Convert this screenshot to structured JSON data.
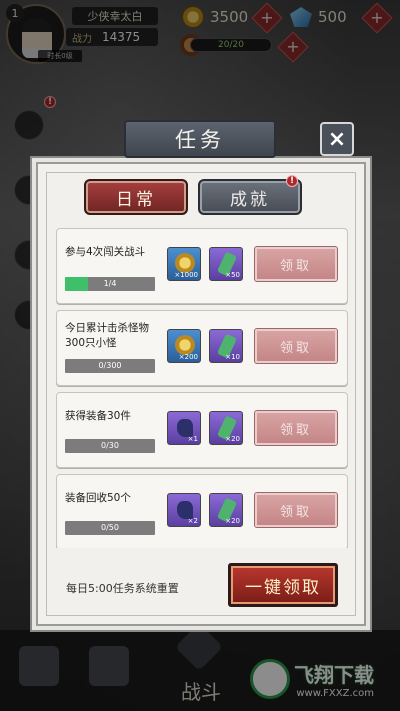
{
  "player": {
    "level": "1",
    "name": "少侠幸太白",
    "power_label": "战力",
    "power": "14375",
    "online": "时长0级"
  },
  "resources": {
    "coins": "3500",
    "gems": "500",
    "stamina": "20/20",
    "plus": "+"
  },
  "modal": {
    "title": "任务",
    "close": "×",
    "tabs": [
      {
        "label": "日常",
        "active": true
      },
      {
        "label": "成就",
        "active": false,
        "badge": "!"
      }
    ],
    "tasks": [
      {
        "name": "参与4次闯关战斗",
        "progress_text": "1/4",
        "progress": 0.25,
        "rewards": [
          {
            "icon": "coin-icon",
            "qty": "×1000",
            "color": "blue"
          },
          {
            "icon": "scroll-icon",
            "qty": "×50",
            "color": "purple"
          }
        ],
        "claim": "领取"
      },
      {
        "name": "今日累计击杀怪物300只小怪",
        "progress_text": "0/300",
        "progress": 0,
        "rewards": [
          {
            "icon": "coin-icon",
            "qty": "×200",
            "color": "blue"
          },
          {
            "icon": "scroll-icon",
            "qty": "×10",
            "color": "purple"
          }
        ],
        "claim": "领取"
      },
      {
        "name": "获得装备30件",
        "progress_text": "0/30",
        "progress": 0,
        "rewards": [
          {
            "icon": "boot-icon",
            "qty": "×1",
            "color": "purple"
          },
          {
            "icon": "scroll-icon",
            "qty": "×20",
            "color": "purple"
          }
        ],
        "claim": "领取"
      },
      {
        "name": "装备回收50个",
        "progress_text": "0/50",
        "progress": 0,
        "rewards": [
          {
            "icon": "boot-icon",
            "qty": "×2",
            "color": "purple"
          },
          {
            "icon": "scroll-icon",
            "qty": "×20",
            "color": "purple"
          }
        ],
        "claim": "领取"
      }
    ],
    "reset_notice": "每日5:00任务系统重置",
    "claim_all": "一键领取"
  },
  "nav": {
    "battle": "战斗"
  },
  "watermark": {
    "main": "飞翔下载",
    "sub": "www.FXXZ.com"
  },
  "colors": {
    "accent_red": "#a83f3f",
    "progress_green": "#3fbf6a",
    "claim_disabled": "#d9a3a3"
  }
}
